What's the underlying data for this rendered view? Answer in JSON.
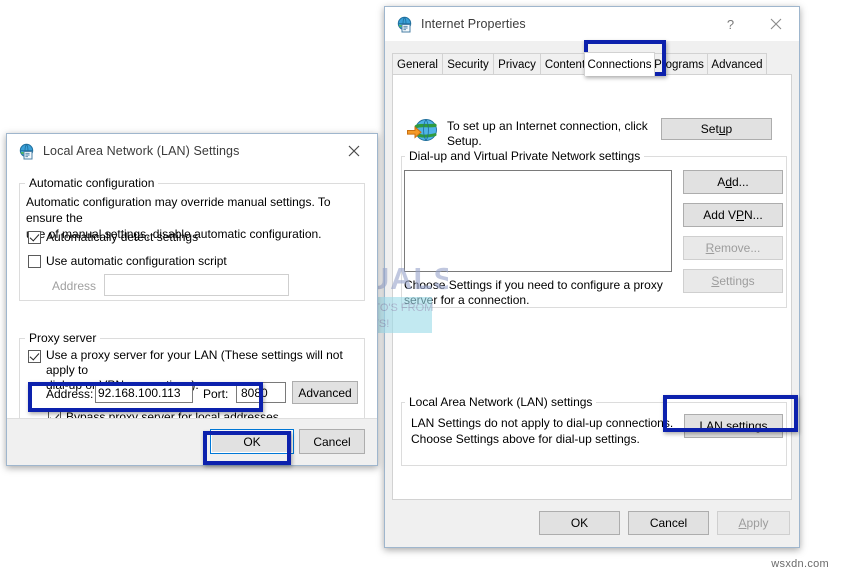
{
  "internet_properties": {
    "title": "Internet Properties",
    "icon": "internet-properties-icon",
    "help_glyph": "?",
    "close_glyph": "✕",
    "tabs": [
      {
        "label": "General",
        "active": false
      },
      {
        "label": "Security",
        "active": false
      },
      {
        "label": "Privacy",
        "active": false
      },
      {
        "label": "Content",
        "active": false
      },
      {
        "label": "Connections",
        "active": true
      },
      {
        "label": "Programs",
        "active": false
      },
      {
        "label": "Advanced",
        "active": false
      }
    ],
    "setup": {
      "icon": "globe-with-arrow-icon",
      "text_line1": "To set up an Internet connection, click",
      "text_line2": "Setup.",
      "button": "Setup",
      "button_accel": "u"
    },
    "dialup_group": {
      "label": "Dial-up and Virtual Private Network settings",
      "list_items": [],
      "buttons": [
        {
          "label": "Add...",
          "accel": "d",
          "disabled": false,
          "name": "add-button"
        },
        {
          "label": "Add VPN...",
          "accel": "P",
          "disabled": false,
          "name": "add-vpn-button"
        },
        {
          "label": "Remove...",
          "accel": "R",
          "disabled": true,
          "name": "remove-button"
        },
        {
          "label": "Settings",
          "accel": "S",
          "disabled": true,
          "name": "settings-button"
        }
      ],
      "hint_line1": "Choose Settings if you need to configure a proxy",
      "hint_line2": "server for a connection."
    },
    "lan_group": {
      "label": "Local Area Network (LAN) settings",
      "text_line1": "LAN Settings do not apply to dial-up connections.",
      "text_line2": "Choose Settings above for dial-up settings.",
      "button": "LAN settings",
      "button_accel": "L"
    },
    "footer_buttons": [
      {
        "label": "OK",
        "disabled": false,
        "name": "ok-button"
      },
      {
        "label": "Cancel",
        "disabled": false,
        "name": "cancel-button"
      },
      {
        "label": "Apply",
        "disabled": true,
        "name": "apply-button",
        "accel": "A"
      }
    ]
  },
  "lan_settings": {
    "title": "Local Area Network (LAN) Settings",
    "icon": "lan-settings-icon",
    "close_glyph": "✕",
    "auto_config": {
      "group_label": "Automatic configuration",
      "text_line1": "Automatic configuration may override manual settings.  To ensure the",
      "text_line2": "use of manual settings, disable automatic configuration.",
      "auto_detect": {
        "label": "Automatically detect settings",
        "checked": true
      },
      "use_script": {
        "label": "Use automatic configuration script",
        "checked": false
      },
      "address_label": "Address",
      "address_value": "",
      "address_disabled": true
    },
    "proxy": {
      "group_label": "Proxy server",
      "use_proxy": {
        "label_line1": "Use a proxy server for your LAN (These settings will not apply to",
        "label_line2": "dial-up or VPN connections).",
        "checked": true
      },
      "address_label": "Address:",
      "address_value": "92.168.100.113",
      "port_label": "Port:",
      "port_value": "8080",
      "advanced_button": "Advanced",
      "bypass": {
        "label": "Bypass proxy server for local addresses",
        "checked": true
      }
    },
    "footer_buttons": [
      {
        "label": "OK",
        "default": true,
        "name": "ok-button"
      },
      {
        "label": "Cancel",
        "default": false,
        "name": "cancel-button"
      }
    ]
  },
  "watermark": {
    "brand": "APPUALS",
    "tagline_line1": "TECH HOW-TO'S FROM",
    "tagline_line2": "THE EXPERTS!",
    "site": "wsxdn.com"
  },
  "annotations": {
    "color": "#0c21ad",
    "boxes": [
      "connections-tab",
      "lan-settings-button",
      "bypass-proxy-checkbox",
      "lan-ok-button"
    ]
  }
}
